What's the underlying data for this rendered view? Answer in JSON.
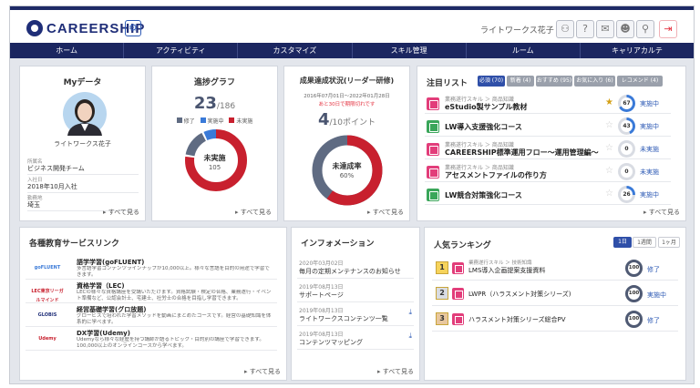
{
  "header": {
    "logo_text": "CAREERSHIP",
    "user_name": "ライトワークス花子",
    "tools": [
      {
        "name": "lightbulb-icon",
        "glyph": "⚇"
      },
      {
        "name": "help-icon",
        "glyph": "?"
      },
      {
        "name": "mail-icon",
        "glyph": "✉"
      },
      {
        "name": "user-icon",
        "glyph": "☻"
      },
      {
        "name": "search-icon",
        "glyph": "⚲"
      },
      {
        "name": "logout-icon",
        "glyph": "⇥"
      }
    ]
  },
  "nav": [
    "ホーム",
    "アクティビティ",
    "カスタマイズ",
    "スキル管理",
    "ルーム",
    "キャリアカルテ"
  ],
  "my_data": {
    "title": "Myデータ",
    "name": "ライトワークス花子",
    "fields": [
      {
        "label": "所属名",
        "value": "ビジネス開発チーム"
      },
      {
        "label": "入社日",
        "value": "2018年10月入社"
      },
      {
        "label": "勤務地",
        "value": "埼玉"
      }
    ],
    "more": "すべて見る"
  },
  "progress_graph": {
    "title": "進捗グラフ",
    "done_count": "23",
    "total": "/186",
    "legend": [
      "修了",
      "実施中",
      "未実施"
    ],
    "center_label": "未実施",
    "center_value": "105",
    "more": "すべて見る",
    "colors": {
      "done": "#5f6b82",
      "in_progress": "#3a7ad8",
      "not_started": "#c8202e"
    }
  },
  "goal_status": {
    "title": "成果達成状況(リーダー研修)",
    "period": "2016年07月01日〜2022年01月28日",
    "notice": "あと30日で期限切れです",
    "points": "4",
    "points_total": "/10ポイント",
    "center_label": "未達成率",
    "center_value": "60%",
    "more": "すべて見る"
  },
  "attention_list": {
    "title": "注目リスト",
    "tabs": [
      "必須 (70)",
      "新着 (4)",
      "おすすめ (95)",
      "お気に入り (6)",
      "レコメンド (4)"
    ],
    "items": [
      {
        "category": "業務遂行スキル ＞ 商品知識",
        "title": "eStudio製サンプル教材",
        "starred": true,
        "progress": "67",
        "status": "実施中",
        "icon": "pink"
      },
      {
        "category": "",
        "title": "LW導入支援強化コース",
        "starred": false,
        "progress": "43",
        "status": "実施中",
        "icon": "green"
      },
      {
        "category": "業務遂行スキル ＞ 商品知識",
        "title": "CAREERSHIP標準運用フロー～運用管理編～",
        "starred": false,
        "progress": "0",
        "status": "未実施",
        "icon": "pink"
      },
      {
        "category": "業務遂行スキル ＞ 商品知識",
        "title": "アセスメントファイルの作り方",
        "starred": false,
        "progress": "0",
        "status": "未実施",
        "icon": "pink"
      },
      {
        "category": "",
        "title": "LW競合対策強化コース",
        "starred": false,
        "progress": "26",
        "status": "実施中",
        "icon": "green"
      }
    ],
    "more": "すべて見る"
  },
  "services": {
    "title": "各種教育サービスリンク",
    "items": [
      {
        "logo": "goFLUENT",
        "logo_color": "#3a7ad8",
        "title": "語学学習(goFLUENT)",
        "desc": "多言語学習コンテンツラインナップが10,000以上。様々な言語を目的の用途で学習できます。"
      },
      {
        "logo": "LEC東京リーガルマインド",
        "logo_color": "#c8202e",
        "title": "資格学習（LEC)",
        "desc": "LECの様々な資格講座を受講いただけます。資格試験・検定の合格、業務遂行・イベント準備など、公認会計士、宅建士、社労士の合格を目指し学習できます。"
      },
      {
        "logo": "GLOBIS",
        "logo_color": "#1f2e78",
        "title": "経営基礎学習(グロ放題)",
        "desc": "グロービスで培われた学習メソッドを動画にまとめたコースです。経営の基礎知識を体系的に学べます。"
      },
      {
        "logo": "Udemy",
        "logo_color": "#c8202e",
        "title": "DX学習(Udemy)",
        "desc": "Udemyなら様々な経歴を持つ講師が語るトピック・目的別の講座で学習できます。100,000以上のオンラインコースから学べます。"
      }
    ],
    "more": "すべて見る"
  },
  "information": {
    "title": "インフォメーション",
    "items": [
      {
        "date": "2020年03月02日",
        "title": "毎月の定期メンテナンスのお知らせ",
        "download": false
      },
      {
        "date": "2019年08月13日",
        "title": "サポートページ",
        "download": false
      },
      {
        "date": "2019年08月13日",
        "title": "ライトワークスコンテンツ一覧",
        "download": true
      },
      {
        "date": "2019年08月13日",
        "title": "コンテンツマッピング",
        "download": true
      }
    ],
    "more": "すべて見る"
  },
  "ranking": {
    "title": "人気ランキング",
    "tabs": [
      "1日",
      "1週間",
      "1ヶ月"
    ],
    "items": [
      {
        "rank": "1",
        "category": "業務遂行スキル ＞ 技術知識",
        "title": "LMS導入企画提案支援資料",
        "progress": "100",
        "status": "修了"
      },
      {
        "rank": "2",
        "category": "",
        "title": "LWPR（ハラスメント対策シリーズ)",
        "progress": "100",
        "status": "実施中"
      },
      {
        "rank": "3",
        "category": "",
        "title": "ハラスメント対策シリーズ総合PV",
        "progress": "100",
        "status": "修了"
      }
    ]
  }
}
